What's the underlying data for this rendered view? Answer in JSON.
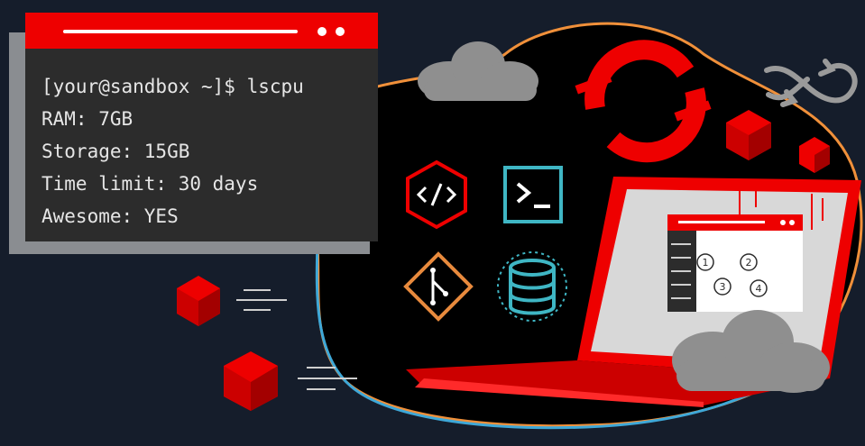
{
  "terminal": {
    "lines": [
      "[your@sandbox ~]$ lscpu",
      "RAM: 7GB",
      "Storage: 15GB",
      "Time limit: 30 days",
      "Awesome: YES"
    ]
  },
  "colors": {
    "background": "#151d2b",
    "brand_red": "#ee0000",
    "terminal_bg": "#2c2c2c",
    "cloud_gray": "#8f8f8f",
    "blob_outline_orange": "#f0903a",
    "blob_outline_blue": "#3ea8d8",
    "icon_teal": "#3fb6c4",
    "icon_orange": "#e88a3d"
  },
  "icons": [
    "openshift-logo-icon",
    "code-icon",
    "terminal-prompt-icon",
    "git-branch-icon",
    "database-icon",
    "cloud-icon",
    "cube-icon",
    "infinity-arrows-icon",
    "laptop-icon"
  ],
  "laptop_screen": {
    "steps": [
      "1",
      "2",
      "3",
      "4"
    ]
  }
}
